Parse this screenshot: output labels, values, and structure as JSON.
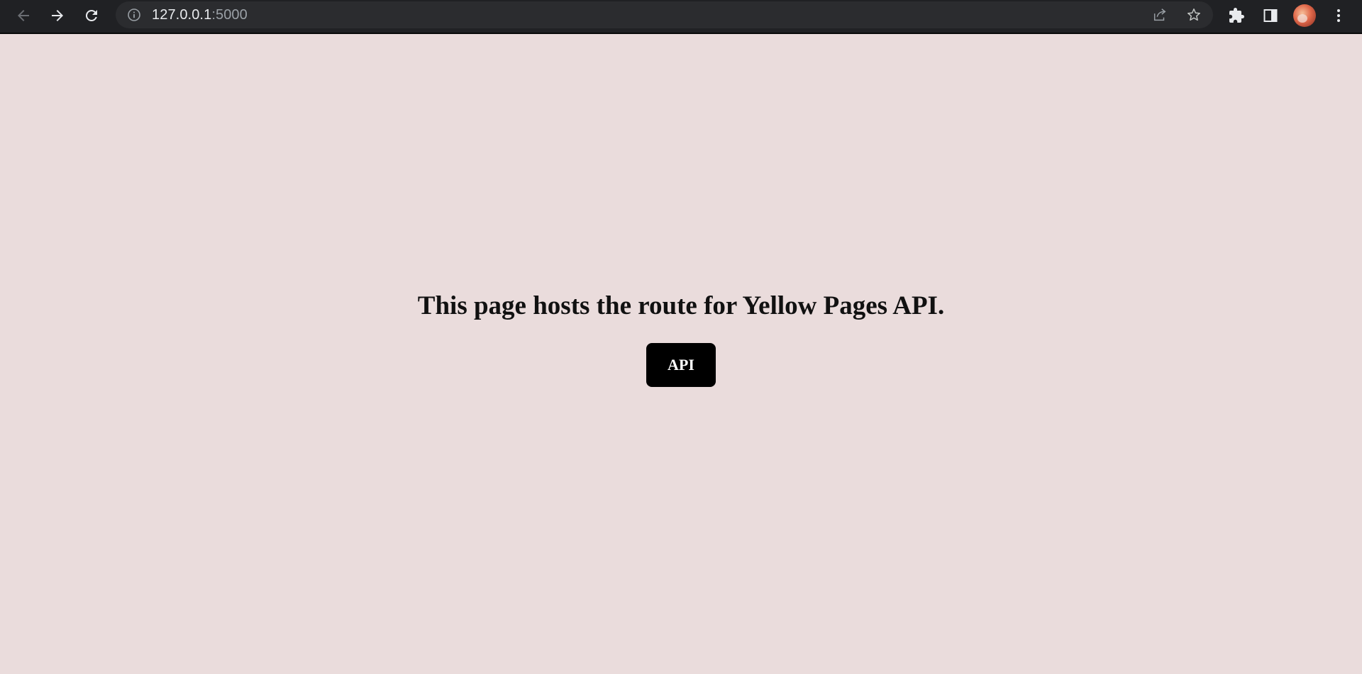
{
  "browser": {
    "url_host": "127.0.0.1",
    "url_port": ":5000",
    "icons": {
      "back": "arrow-left-icon",
      "forward": "arrow-right-icon",
      "reload": "reload-icon",
      "site_info": "info-icon",
      "share": "share-icon",
      "bookmark": "star-icon",
      "extensions": "puzzle-icon",
      "side_panel": "side-panel-icon",
      "profile": "avatar",
      "menu": "kebab-menu-icon"
    }
  },
  "page": {
    "background_color": "#eadcdc",
    "headline": "This page hosts the route for Yellow Pages API.",
    "api_button_label": "API",
    "api_button_color": "#000000"
  }
}
